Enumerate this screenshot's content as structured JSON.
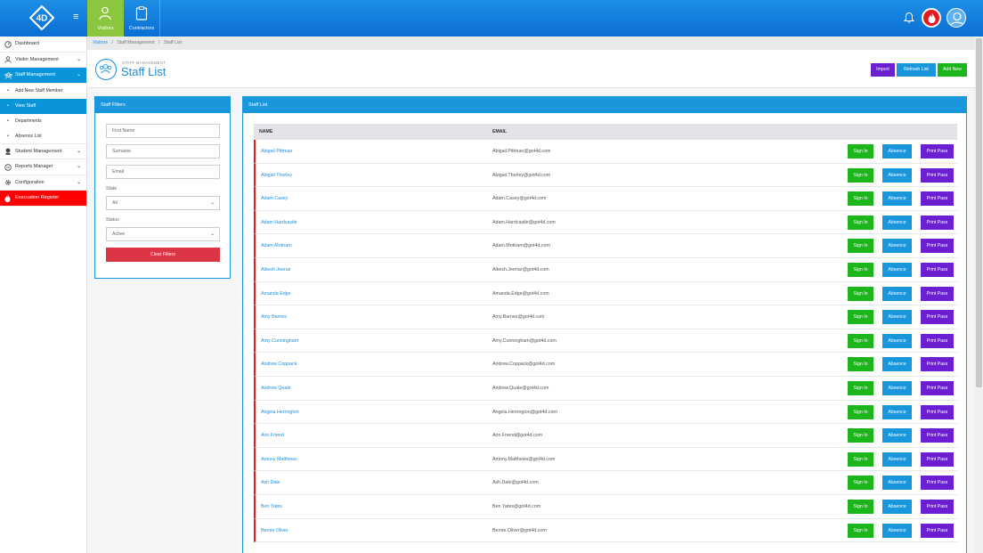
{
  "topbar": {
    "logo_text": "4D",
    "tabs": [
      {
        "label": "Visitors"
      },
      {
        "label": "Contractors"
      }
    ]
  },
  "sidebar": {
    "items": [
      {
        "label": "Dashboard",
        "icon": "speedometer-icon"
      },
      {
        "label": "Visitor Management",
        "icon": "user-icon"
      },
      {
        "label": "Staff Management",
        "icon": "group-icon"
      },
      {
        "label": "Add New Staff Member"
      },
      {
        "label": "View Staff"
      },
      {
        "label": "Departments"
      },
      {
        "label": "Absence List"
      },
      {
        "label": "Student Management",
        "icon": "student-icon"
      },
      {
        "label": "Reports Manager",
        "icon": "reports-icon"
      },
      {
        "label": "Configuration",
        "icon": "gear-icon"
      },
      {
        "label": "Evacuation Register",
        "icon": "fire-icon"
      }
    ]
  },
  "breadcrumb": {
    "items": [
      "Visitors",
      "Staff Management",
      "Staff List"
    ],
    "separator": "/"
  },
  "header": {
    "kicker": "STAFF MANAGEMENT",
    "title": "Staff List",
    "import_label": "Import",
    "refresh_label": "Refresh List",
    "add_label": "Add New"
  },
  "filters": {
    "title": "Staff Filters",
    "first_name_placeholder": "First Name",
    "surname_placeholder": "Surname",
    "email_placeholder": "Email",
    "state_label": "State",
    "state_value": "All",
    "status_label": "Status",
    "status_value": "Active",
    "clear_label": "Clear Filters"
  },
  "list": {
    "title": "Staff List",
    "col_name": "NAME",
    "col_email": "EMAIL",
    "signin_label": "Sign In",
    "absence_label": "Absence",
    "print_label": "Print Pass",
    "rows": [
      {
        "name": "Abigail Pittman",
        "email": "Abigail.Pittman@got4d.com"
      },
      {
        "name": "Abigail Thorley",
        "email": "Abigail.Thorley@got4d.com"
      },
      {
        "name": "Adam Casey",
        "email": "Adam.Casey@got4d.com"
      },
      {
        "name": "Adam Hardcastle",
        "email": "Adam.Hardcastle@got4d.com"
      },
      {
        "name": "Adam Mottram",
        "email": "Adam.Mottram@got4d.com"
      },
      {
        "name": "Alkesh Jeenar",
        "email": "Alkesh.Jeenar@got4d.com"
      },
      {
        "name": "Amanda Edge",
        "email": "Amanda.Edge@got4d.com"
      },
      {
        "name": "Amy Barnes",
        "email": "Amy.Barnes@got4d.com"
      },
      {
        "name": "Amy Cunningham",
        "email": "Amy.Cunningham@got4d.com"
      },
      {
        "name": "Andrew Coppack",
        "email": "Andrew.Coppack@got4d.com"
      },
      {
        "name": "Andrew Quale",
        "email": "Andrew.Quale@got4d.com"
      },
      {
        "name": "Angela Herrington",
        "email": "Angela.Herrington@got4d.com"
      },
      {
        "name": "Ann Friend",
        "email": "Ann.Friend@got4d.com"
      },
      {
        "name": "Antony Matthews",
        "email": "Antony.Matthews@got4d.com"
      },
      {
        "name": "Ash Dale",
        "email": "Ash.Dale@got4d.com"
      },
      {
        "name": "Ben Yates",
        "email": "Ben.Yates@got4d.com"
      },
      {
        "name": "Bernie Oliver",
        "email": "Bernie.Oliver@got4d.com"
      }
    ]
  },
  "colors": {
    "primary": "#1a97dc",
    "visitors_tab": "#8cc63f",
    "success": "#1cb51c",
    "purple": "#6b1fd1",
    "danger": "#dc3545",
    "evacuation": "#ff0000"
  }
}
